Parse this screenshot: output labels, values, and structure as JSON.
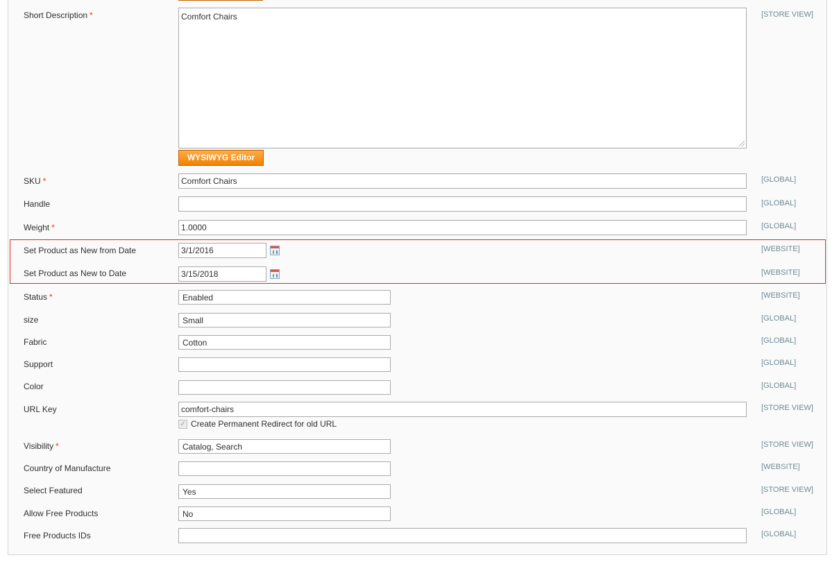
{
  "editor_button": "WYSIWYG Editor",
  "fields": {
    "short_description": {
      "label": "Short Description",
      "required": "*",
      "value": "Comfort Chairs",
      "scope": "[STORE VIEW]"
    },
    "sku": {
      "label": "SKU",
      "required": "*",
      "value": "Comfort Chairs",
      "scope": "[GLOBAL]"
    },
    "handle": {
      "label": "Handle",
      "value": "",
      "scope": "[GLOBAL]"
    },
    "weight": {
      "label": "Weight",
      "required": "*",
      "value": "1.0000",
      "scope": "[GLOBAL]"
    },
    "new_from": {
      "label": "Set Product as New from Date",
      "value": "3/1/2016",
      "scope": "[WEBSITE]"
    },
    "new_to": {
      "label": "Set Product as New to Date",
      "value": "3/15/2018",
      "scope": "[WEBSITE]"
    },
    "status": {
      "label": "Status",
      "required": "*",
      "value": "Enabled",
      "scope": "[WEBSITE]"
    },
    "size": {
      "label": "size",
      "value": "Small",
      "scope": "[GLOBAL]"
    },
    "fabric": {
      "label": "Fabric",
      "value": "Cotton",
      "scope": "[GLOBAL]"
    },
    "support": {
      "label": "Support",
      "value": "",
      "scope": "[GLOBAL]"
    },
    "color": {
      "label": "Color",
      "value": "",
      "scope": "[GLOBAL]"
    },
    "url_key": {
      "label": "URL Key",
      "value": "comfort-chairs",
      "scope": "[STORE VIEW]",
      "redirect_label": "Create Permanent Redirect for old URL",
      "redirect_checked": "✓"
    },
    "visibility": {
      "label": "Visibility",
      "required": "*",
      "value": "Catalog, Search",
      "scope": "[STORE VIEW]"
    },
    "country": {
      "label": "Country of Manufacture",
      "value": "",
      "scope": "[WEBSITE]"
    },
    "featured": {
      "label": "Select Featured",
      "value": "Yes",
      "scope": "[STORE VIEW]"
    },
    "free_products": {
      "label": "Allow Free Products",
      "value": "No",
      "scope": "[GLOBAL]"
    },
    "free_ids": {
      "label": "Free Products IDs",
      "value": "",
      "scope": "[GLOBAL]"
    }
  },
  "colors": {
    "accent": "#f18200",
    "required": "#eb340a",
    "scope": "#6f8992",
    "highlight": "#e02b2b"
  }
}
